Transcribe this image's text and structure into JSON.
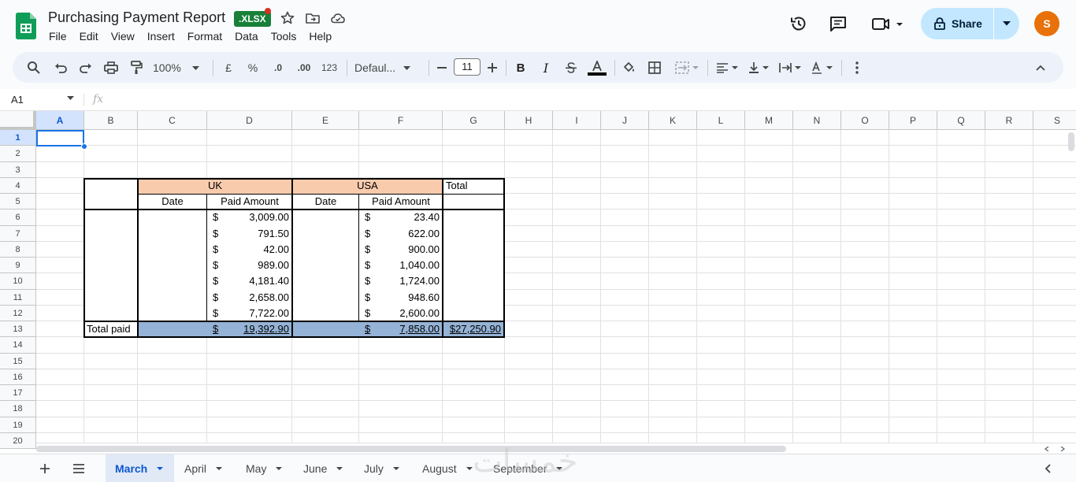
{
  "app": {
    "doc_title": "Purchasing Payment Report",
    "badge": ".XLSX",
    "menu": [
      "File",
      "Edit",
      "View",
      "Insert",
      "Format",
      "Data",
      "Tools",
      "Help"
    ],
    "share_label": "Share",
    "avatar_initial": "S"
  },
  "toolbar": {
    "zoom": "100%",
    "currency": "£",
    "percent": "%",
    "dec_dec": ".0",
    "inc_dec": ".00",
    "num_format": "123",
    "font": "Defaul...",
    "font_size": "11"
  },
  "formula_bar": {
    "cell_ref": "A1",
    "fx": "fx"
  },
  "grid": {
    "columns": [
      "A",
      "B",
      "C",
      "D",
      "E",
      "F",
      "G",
      "H",
      "I",
      "J",
      "K",
      "L",
      "M",
      "N",
      "O",
      "P",
      "Q",
      "R",
      "S"
    ],
    "rows": [
      "1",
      "2",
      "3",
      "4",
      "5",
      "6",
      "7",
      "8",
      "9",
      "10",
      "11",
      "12",
      "13",
      "14",
      "15",
      "16",
      "17",
      "18",
      "19",
      "20"
    ],
    "selected_cell": "A1"
  },
  "report": {
    "uk_header": "UK",
    "usa_header": "USA",
    "total_header": "Total",
    "date_label": "Date",
    "paid_label": "Paid Amount",
    "currency_symbol": "$",
    "uk_amounts": [
      "3,009.00",
      "791.50",
      "42.00",
      "989.00",
      "4,181.40",
      "2,658.00",
      "7,722.00"
    ],
    "usa_amounts": [
      "23.40",
      "622.00",
      "900.00",
      "1,040.00",
      "1,724.00",
      "948.60",
      "2,600.00"
    ],
    "total_paid_label": "Total paid",
    "uk_total": "19,392.90",
    "usa_total": "7,858.00",
    "grand_total": "$27,250.90",
    "colors": {
      "header_fill": "#f8cbad",
      "total_fill": "#95b3d7"
    }
  },
  "sheets": {
    "tabs": [
      "March",
      "April",
      "May",
      "June",
      "July",
      "August",
      "September"
    ],
    "active": "March"
  },
  "watermark": "خمسات"
}
